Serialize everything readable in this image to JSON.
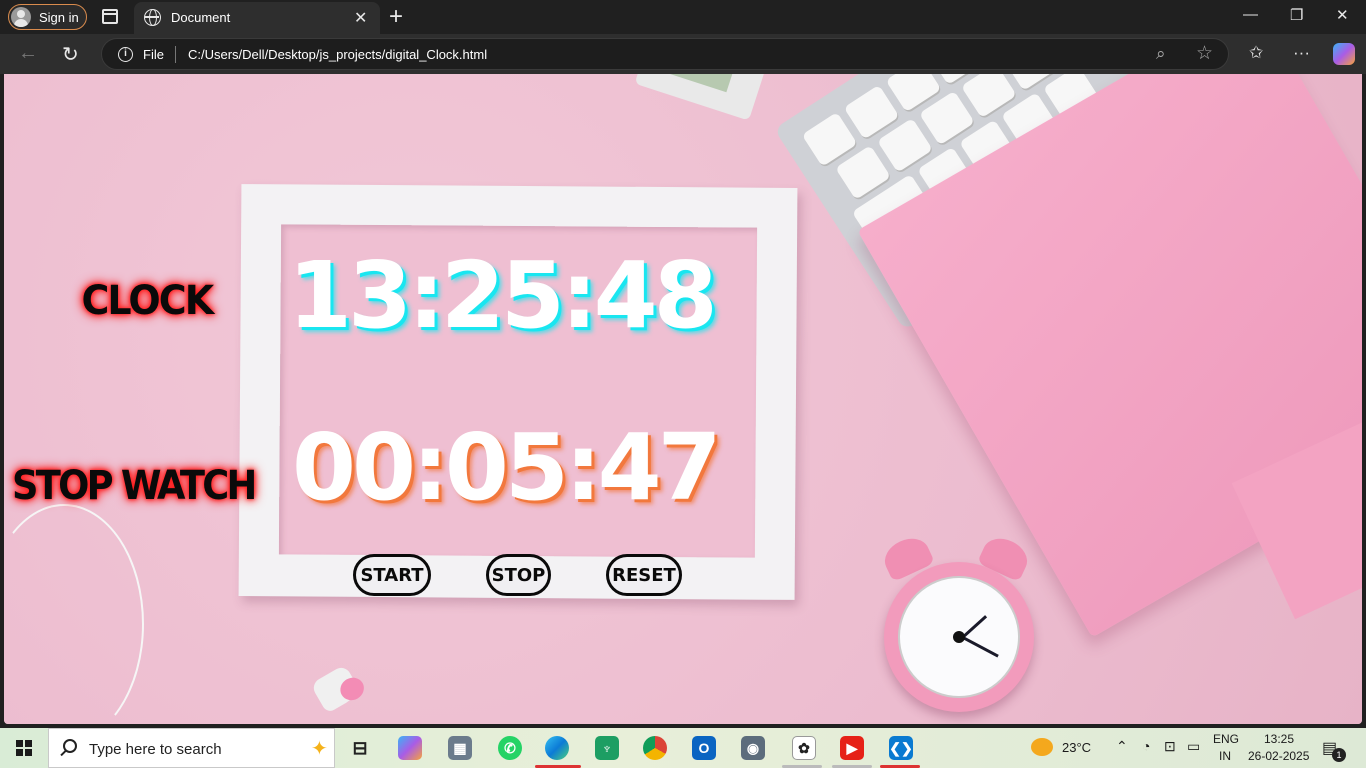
{
  "browser": {
    "signin_label": "Sign in",
    "tab_title": "Document",
    "address_scheme": "File",
    "address_url": "C:/Users/Dell/Desktop/js_projects/digital_Clock.html"
  },
  "page": {
    "clock_label": "CLOCK",
    "stopwatch_label": "STOP WATCH",
    "clock_time": "13:25:48",
    "stopwatch_time": "00:05:47",
    "buttons": {
      "start": "START",
      "stop": "STOP",
      "reset": "RESET"
    },
    "colors": {
      "clock_glow": "#19e6f0",
      "stopwatch_glow": "#f2783d",
      "label_glow": "#ff1a1a",
      "background": "#efc1d3"
    }
  },
  "taskbar": {
    "search_placeholder": "Type here to search",
    "weather": "23°C",
    "lang_line1": "ENG",
    "lang_line2": "IN",
    "time": "13:25",
    "date": "26-02-2025",
    "notification_count": "1",
    "apps": [
      "task-view",
      "copilot",
      "calculator",
      "whatsapp",
      "edge",
      "app-green",
      "chrome",
      "outlook",
      "camera",
      "chatgpt",
      "youtube",
      "vscode"
    ]
  }
}
